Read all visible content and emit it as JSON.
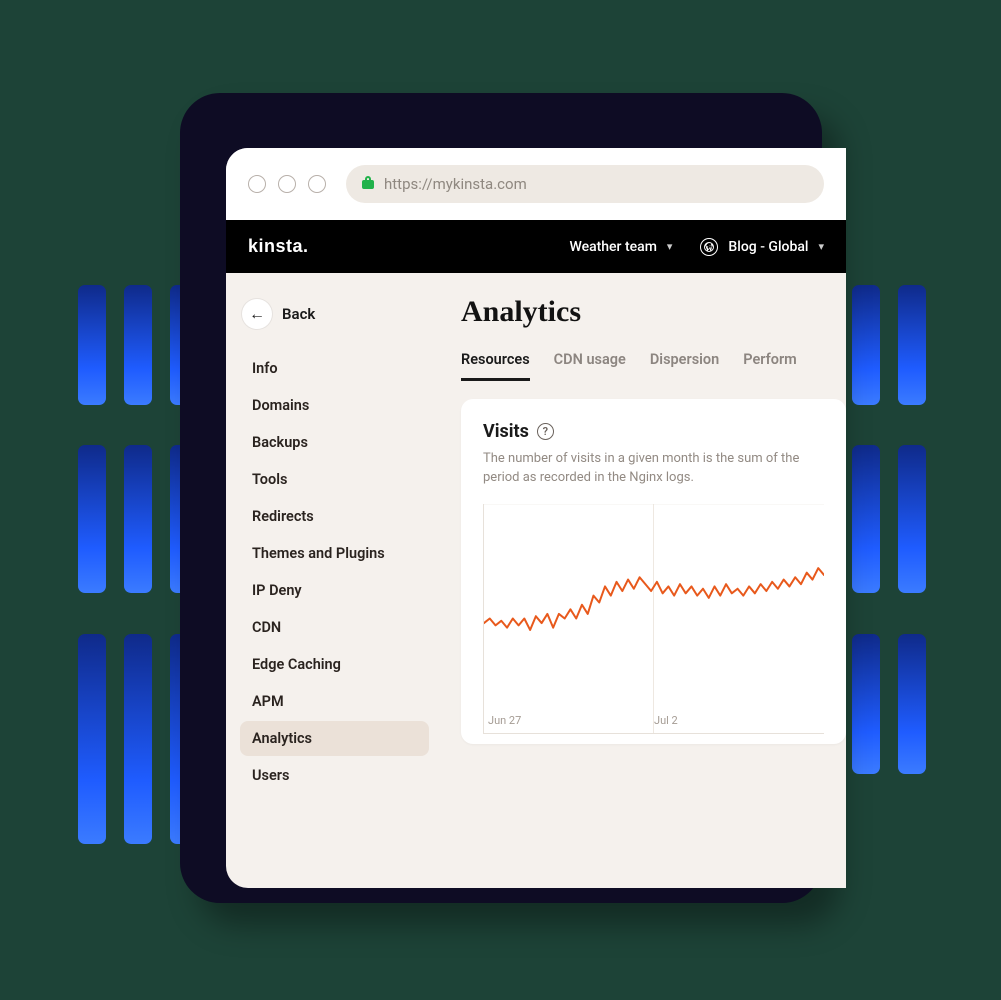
{
  "url": "https://mykinsta.com",
  "brand": "kinsta",
  "topnav": {
    "team_label": "Weather team",
    "site_label": "Blog - Global"
  },
  "sidebar": {
    "back_label": "Back",
    "items": [
      {
        "label": "Info"
      },
      {
        "label": "Domains"
      },
      {
        "label": "Backups"
      },
      {
        "label": "Tools"
      },
      {
        "label": "Redirects"
      },
      {
        "label": "Themes and Plugins"
      },
      {
        "label": "IP Deny"
      },
      {
        "label": "CDN"
      },
      {
        "label": "Edge Caching"
      },
      {
        "label": "APM"
      },
      {
        "label": "Analytics"
      },
      {
        "label": "Users"
      }
    ],
    "active_index": 10
  },
  "page": {
    "title": "Analytics",
    "tabs": [
      "Resources",
      "CDN usage",
      "Dispersion",
      "Performance"
    ],
    "active_tab": 0
  },
  "visits_card": {
    "heading": "Visits",
    "description": "The number of visits in a given month is the sum of the period as recorded in the Nginx logs."
  },
  "chart_data": {
    "type": "line",
    "title": "Visits",
    "xlabel": "",
    "ylabel": "",
    "ylim": [
      0,
      100
    ],
    "categories": [
      "Jun 27",
      "Jul 2"
    ],
    "series": [
      {
        "name": "Visits",
        "color": "#e8591c",
        "values": [
          48,
          50,
          47,
          49,
          46,
          50,
          47,
          50,
          45,
          51,
          48,
          52,
          46,
          52,
          50,
          54,
          50,
          56,
          52,
          60,
          57,
          64,
          60,
          66,
          62,
          67,
          63,
          68,
          65,
          62,
          66,
          61,
          64,
          60,
          65,
          61,
          64,
          60,
          63,
          59,
          64,
          60,
          65,
          61,
          63,
          60,
          64,
          61,
          65,
          62,
          66,
          63,
          67,
          64,
          68,
          65,
          70,
          67,
          72,
          69
        ]
      }
    ]
  }
}
